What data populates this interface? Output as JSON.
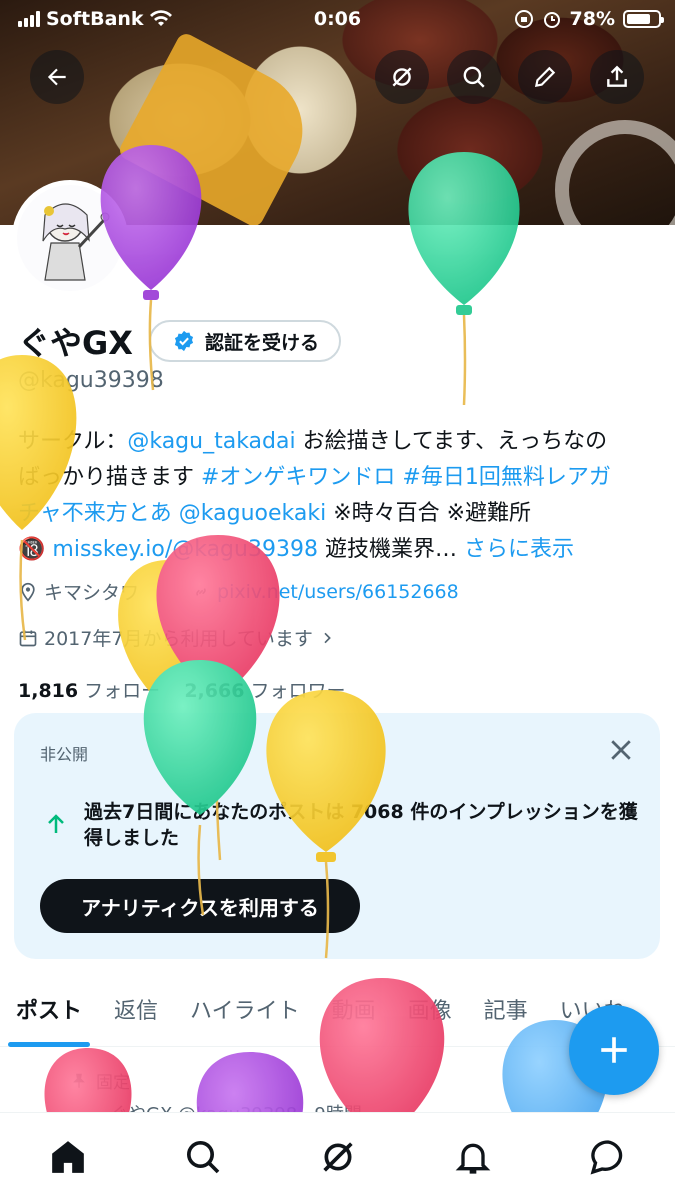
{
  "status_bar": {
    "carrier": "SoftBank",
    "time": "0:06",
    "battery": "78%"
  },
  "profile": {
    "name": "ぐやGX",
    "verify_label": "認証を受ける",
    "handle": "@kagu39398",
    "bio": {
      "line1_prefix": "サークル：",
      "line1_link": "@kagu_takadai",
      "line1_suffix": " お絵描きしてます、えっちなの",
      "line2_prefix": "ばっかり描きます ",
      "line2_link": "#オンゲキワンドロ #毎日1回無料レアガ",
      "line3_link1": "チャ不来方とあ",
      "line3_link2": " @kaguoekaki",
      "line3_suffix": " ※時々百合 ※避難所",
      "line4_icon": "🔞",
      "line4_link": "misskey.io/@kagu39398",
      "line4_suffix": " 遊技機業界… ",
      "more": "さらに表示"
    },
    "location": "キマシタワ",
    "website": "pixiv.net/users/66152668",
    "joined": "2017年7月から利用しています",
    "following_count": "1,816",
    "following_label": " フォロー",
    "followers_count": "2,666",
    "followers_label": " フォロワー"
  },
  "analytics_card": {
    "label": "非公開",
    "text": "過去7日間にあなたのポストは 7068 件のインプレッションを獲得しました",
    "button": "アナリティクスを利用する"
  },
  "tabs": [
    "ポスト",
    "返信",
    "ハイライト",
    "動画",
    "画像",
    "記事",
    "いいね"
  ],
  "pinned_label": "固定",
  "post_peek": "ぐやGX @kagu39398 · 9時間",
  "icons": {
    "back": "arrow-left-icon",
    "grok": "grok-icon",
    "search": "search-icon",
    "edit": "pencil-icon",
    "share": "share-icon",
    "compose": "plus-icon",
    "home": "home-icon",
    "nav_search": "search-icon",
    "nav_grok": "grok-icon",
    "notifications": "bell-icon",
    "messages": "message-icon"
  },
  "colors": {
    "accent": "#1d9bf0",
    "text": "#0f1419",
    "muted": "#536471",
    "card_bg": "#e8f5fd"
  }
}
